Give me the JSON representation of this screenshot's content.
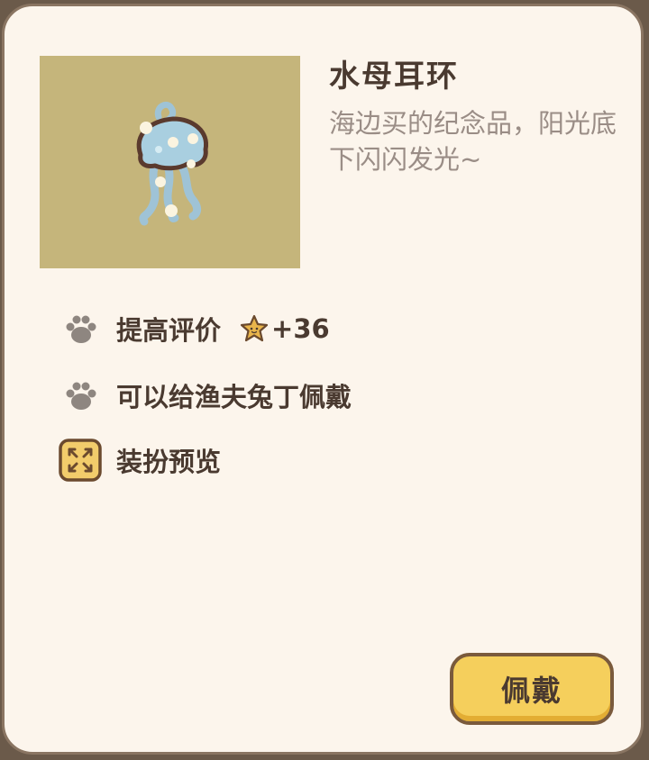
{
  "item": {
    "title": "水母耳环",
    "description": "海边买的纪念品，阳光底下闪闪发光~",
    "image_icon": "jellyfish-earring",
    "image_background": "#c5b57b"
  },
  "attributes": [
    {
      "icon": "paw-icon",
      "label": "提高评价",
      "bonus_icon": "star-icon",
      "bonus_value": "+36"
    },
    {
      "icon": "paw-icon",
      "label": "可以给渔夫兔丁佩戴"
    },
    {
      "icon": "expand-icon",
      "label": "装扮预览"
    }
  ],
  "actions": {
    "equip_label": "佩戴"
  },
  "colors": {
    "panel_background": "#fcf5ec",
    "title_text": "#4a3a30",
    "description_text": "#9a8d86",
    "button_fill": "#f5cf5c",
    "button_border": "#7a5a3c"
  }
}
